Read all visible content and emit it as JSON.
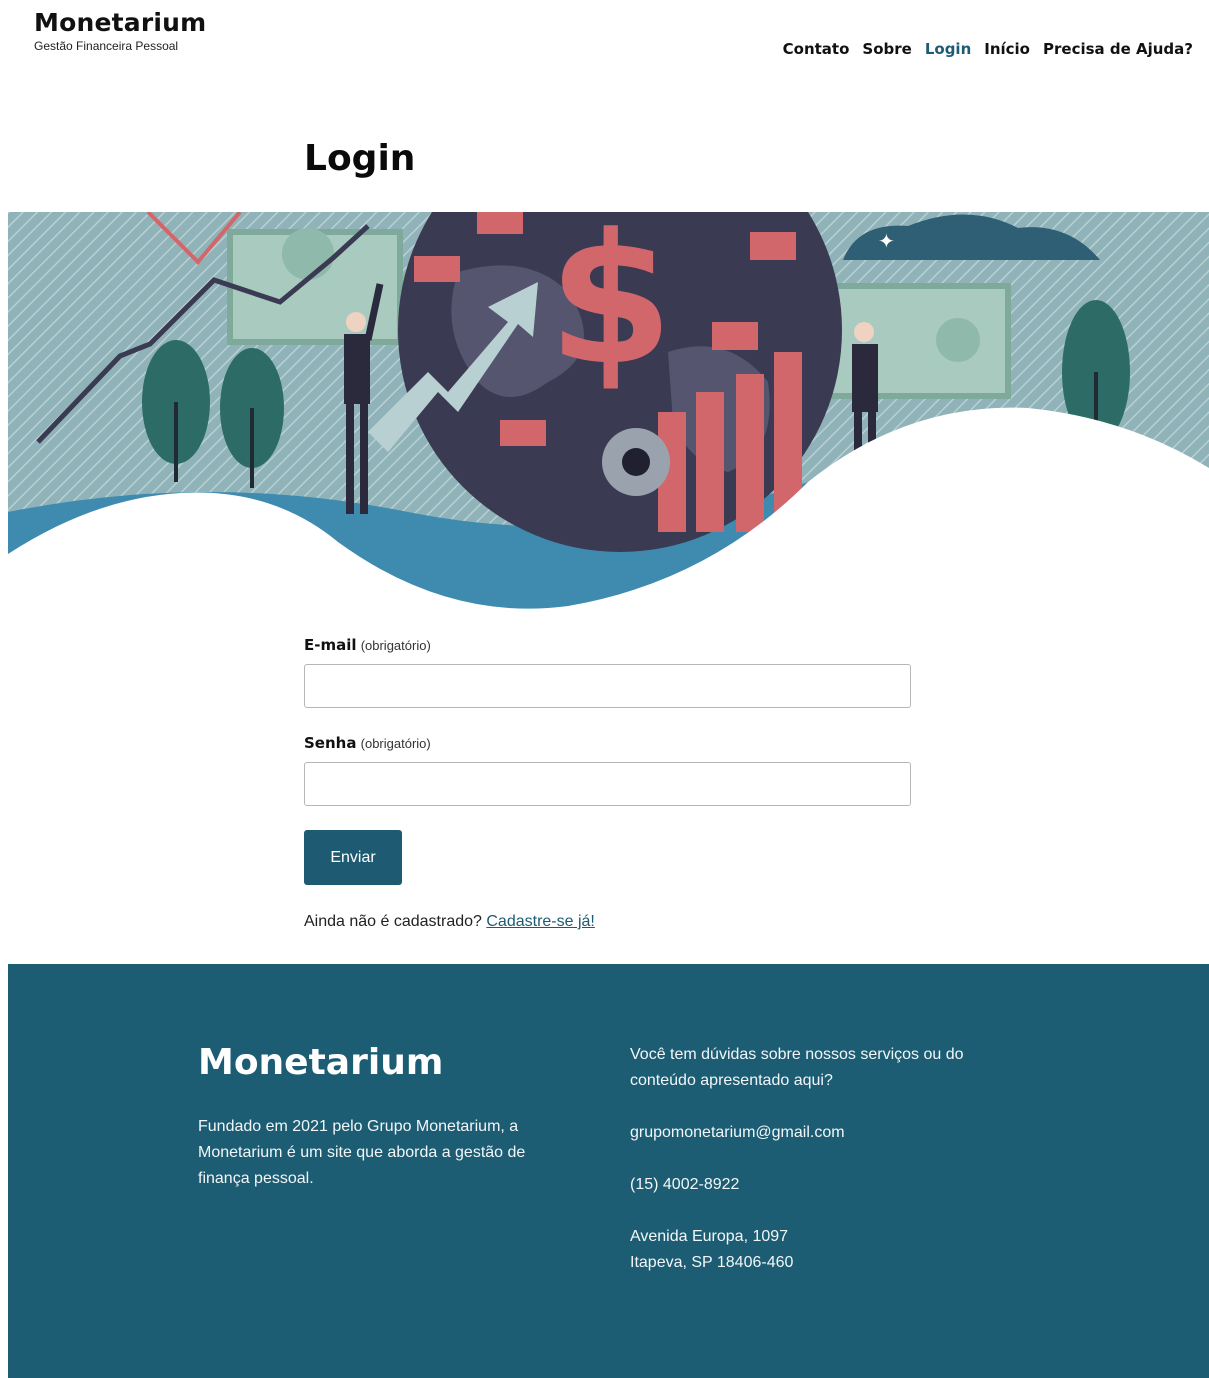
{
  "header": {
    "brand": "Monetarium",
    "tagline": "Gestão Financeira Pessoal",
    "nav": [
      {
        "label": "Contato",
        "active": false
      },
      {
        "label": "Sobre",
        "active": false
      },
      {
        "label": "Login",
        "active": true
      },
      {
        "label": "Início",
        "active": false
      },
      {
        "label": "Precisa de Ajuda?",
        "active": false
      }
    ]
  },
  "page": {
    "title": "Login"
  },
  "form": {
    "email": {
      "label": "E-mail",
      "required": "(obrigatório)",
      "value": ""
    },
    "password": {
      "label": "Senha",
      "required": "(obrigatório)",
      "value": ""
    },
    "submit_label": "Enviar",
    "signup_prompt": "Ainda não é cadastrado?",
    "signup_link": "Cadastre-se já!"
  },
  "footer": {
    "brand": "Monetarium",
    "about": "Fundado em 2021 pelo Grupo Monetarium, a Monetarium é um site que aborda a gestão de finança pessoal.",
    "question": "Você tem dúvidas sobre nossos serviços ou do conteúdo apresentado aqui?",
    "email": "grupomonetarium@gmail.com",
    "phone": "(15) 4002-8922",
    "address_line1": "Avenida Europa, 1097",
    "address_line2": "Itapeva, SP 18406-460"
  },
  "colors": {
    "accent": "#1e5b72",
    "footer_bg": "#1c5d73",
    "hero_sky": "#8ab1b6",
    "hero_blue": "#3f8bb0",
    "hero_red": "#d2676b",
    "hero_globe": "#3a3a52"
  }
}
